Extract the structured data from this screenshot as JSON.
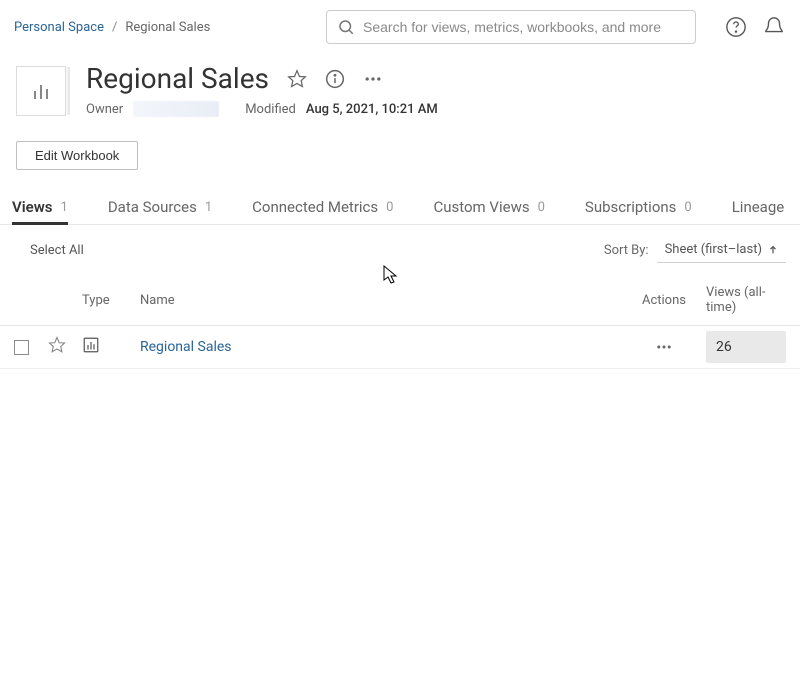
{
  "breadcrumb": {
    "root": "Personal Space",
    "current": "Regional Sales"
  },
  "search": {
    "placeholder": "Search for views, metrics, workbooks, and more"
  },
  "page": {
    "title": "Regional Sales",
    "owner_label": "Owner",
    "modified_label": "Modified",
    "modified_value": "Aug 5, 2021, 10:21 AM"
  },
  "buttons": {
    "edit_workbook": "Edit Workbook"
  },
  "tabs": [
    {
      "label": "Views",
      "count": "1",
      "active": true
    },
    {
      "label": "Data Sources",
      "count": "1",
      "active": false
    },
    {
      "label": "Connected Metrics",
      "count": "0",
      "active": false
    },
    {
      "label": "Custom Views",
      "count": "0",
      "active": false
    },
    {
      "label": "Subscriptions",
      "count": "0",
      "active": false
    },
    {
      "label": "Lineage",
      "count": "",
      "active": false
    }
  ],
  "toolbar": {
    "select_all": "Select All",
    "sort_by_label": "Sort By:",
    "sort_value": "Sheet (first–last)"
  },
  "table": {
    "headers": {
      "type": "Type",
      "name": "Name",
      "actions": "Actions",
      "views": "Views (all-time)"
    },
    "rows": [
      {
        "name": "Regional Sales",
        "views": "26"
      }
    ]
  }
}
